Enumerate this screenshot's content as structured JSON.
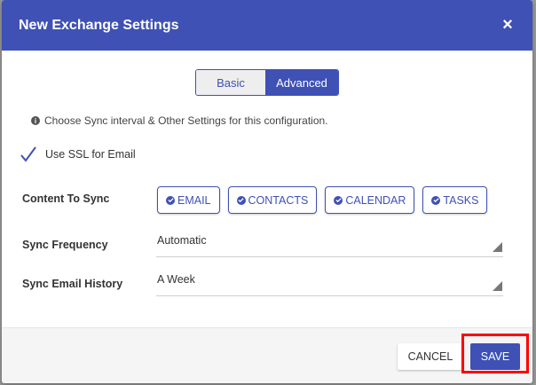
{
  "dialog": {
    "title": "New Exchange Settings",
    "close_icon": "×"
  },
  "mode_toggle": {
    "options": [
      "Basic",
      "Advanced"
    ],
    "selected": "Advanced"
  },
  "info": {
    "icon": "info-icon",
    "text": "Choose Sync interval & Other Settings for this configuration."
  },
  "ssl": {
    "label": "Use SSL for Email",
    "checked": true
  },
  "content_to_sync": {
    "label": "Content To Sync",
    "chips": [
      "EMAIL",
      "CONTACTS",
      "CALENDAR",
      "TASKS"
    ]
  },
  "sync_frequency": {
    "label": "Sync Frequency",
    "value": "Automatic"
  },
  "sync_email_history": {
    "label": "Sync Email History",
    "value": "A Week"
  },
  "footer": {
    "cancel_label": "CANCEL",
    "save_label": "SAVE"
  },
  "colors": {
    "primary": "#3f51b5",
    "highlight": "#ff0000"
  }
}
